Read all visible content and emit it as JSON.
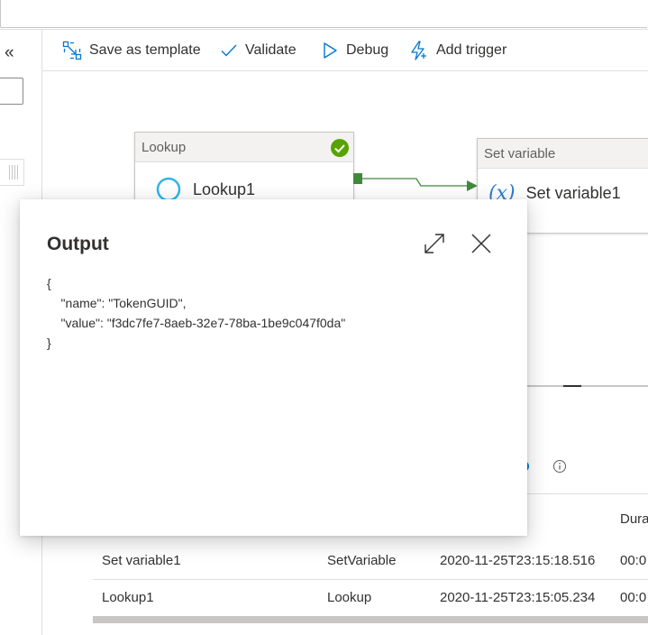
{
  "toolbar": {
    "save_as_template": "Save as template",
    "validate": "Validate",
    "debug": "Debug",
    "add_trigger": "Add trigger"
  },
  "left_rail": {
    "collapse_glyph": "«"
  },
  "canvas": {
    "lookup_node": {
      "type_label": "Lookup",
      "name": "Lookup1",
      "status": "succeeded"
    },
    "setvar_node": {
      "type_label": "Set variable",
      "name": "Set variable1",
      "icon_text": "(x)"
    }
  },
  "output_dialog": {
    "title": "Output",
    "json_text": "{\n    \"name\": \"TokenGUID\",\n    \"value\": \"f3dc7fe7-8aeb-32e7-78ba-1be9c047f0da\"\n}"
  },
  "runs_table": {
    "duration_header": "Dura",
    "rows": [
      {
        "name": "Set variable1",
        "type": "SetVariable",
        "start": "2020-11-25T23:15:18.516",
        "duration": "00:0"
      },
      {
        "name": "Lookup1",
        "type": "Lookup",
        "start": "2020-11-25T23:15:05.234",
        "duration": "00:0"
      }
    ]
  },
  "colors": {
    "accent": "#0078d4",
    "success": "#57a300",
    "connector": "#3f8a3a"
  }
}
